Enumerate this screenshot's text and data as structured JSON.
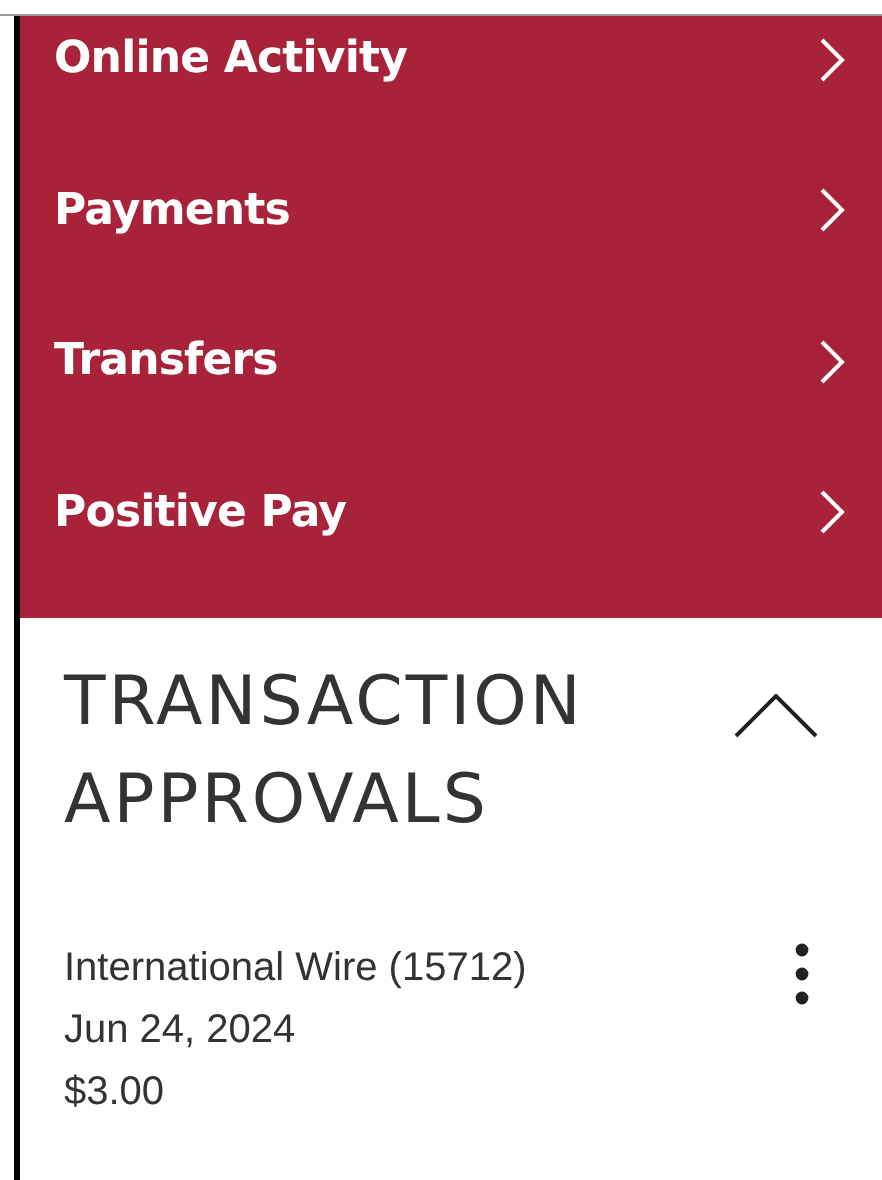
{
  "menu": [
    {
      "label": "Online Activity"
    },
    {
      "label": "Payments"
    },
    {
      "label": "Transfers"
    },
    {
      "label": "Positive Pay"
    }
  ],
  "section": {
    "title": "TRANSACTION APPROVALS",
    "expanded": true,
    "transactions": [
      {
        "name": "International Wire (15712)",
        "date": "Jun 24, 2024",
        "amount": "$3.00"
      }
    ]
  }
}
